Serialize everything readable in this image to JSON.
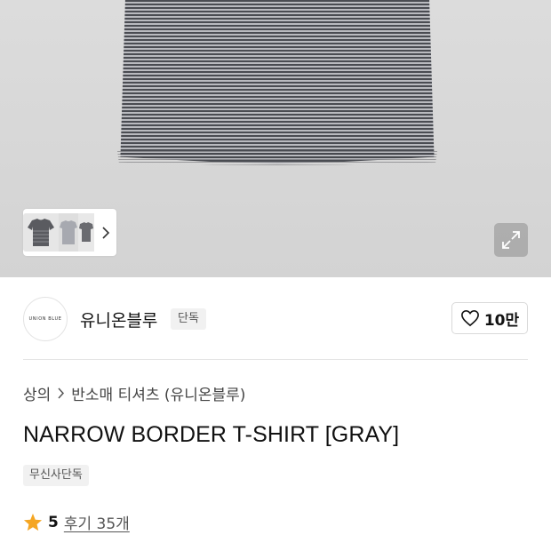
{
  "brand": {
    "logo_text": "UNION BLUE",
    "name": "유니온블루",
    "badge": "단독",
    "likes": "10만"
  },
  "breadcrumb": {
    "category": "상의",
    "subcategory": "반소매 티셔츠 (유니온블루)"
  },
  "product": {
    "title": "NARROW BORDER T-SHIRT [GRAY]",
    "exclusive_badge": "무신사단독"
  },
  "rating": {
    "score": "5",
    "reviews": "후기 35개"
  },
  "icons": {
    "thumb_next": "chevron-right-icon",
    "expand": "expand-icon",
    "like": "heart-icon",
    "breadcrumb_sep": "chevron-right-icon",
    "star": "star-icon"
  },
  "colors": {
    "star": "#f5a623",
    "shirt_dark": "#4a4c52",
    "shirt_light": "#b9babf"
  }
}
